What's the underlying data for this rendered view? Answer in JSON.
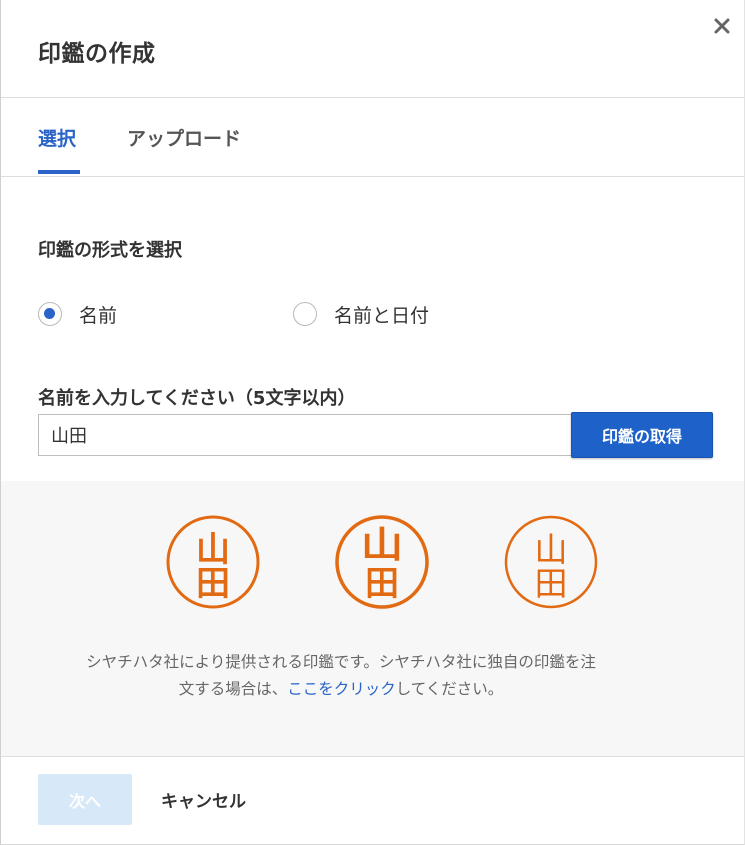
{
  "dialog": {
    "title": "印鑑の作成",
    "close_label": "×"
  },
  "tabs": [
    {
      "label": "選択",
      "active": true
    },
    {
      "label": "アップロード",
      "active": false
    }
  ],
  "format_section": {
    "label": "印鑑の形式を選択",
    "options": [
      {
        "label": "名前",
        "checked": true
      },
      {
        "label": "名前と日付",
        "checked": false
      }
    ]
  },
  "name_section": {
    "label": "名前を入力してください（5文字以内）",
    "value": "山田",
    "get_button_label": "印鑑の取得"
  },
  "stamps": {
    "top_char": "山",
    "bottom_char": "田",
    "color": "#e26a12",
    "count": 3
  },
  "notice": {
    "line1": "シヤチハタ社により提供される印鑑です。シヤチハタ社に独自の印鑑を注",
    "line2_prefix": "文する場合は、",
    "link_text": "ここをクリック",
    "line2_suffix": "してください。"
  },
  "footer": {
    "next_label": "次へ",
    "cancel_label": "キャンセル"
  },
  "colors": {
    "accent": "#2a64c8",
    "primary_button": "#1e62c9",
    "disabled_button": "#d7e9f8",
    "preview_bg": "#f7f7f7"
  }
}
